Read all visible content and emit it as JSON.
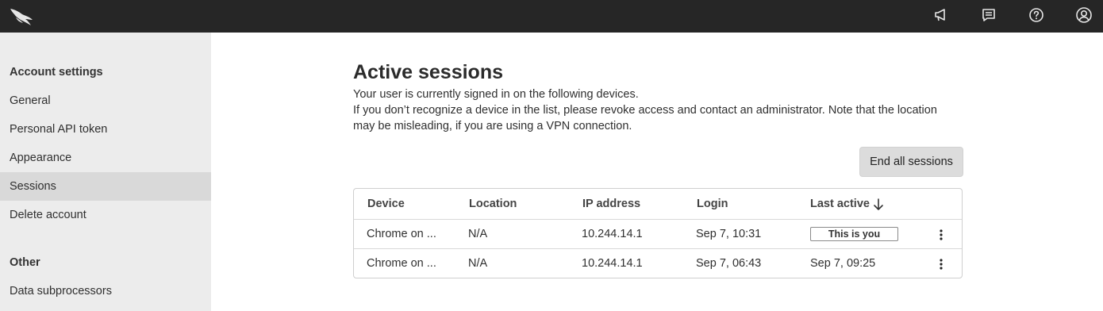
{
  "topbar": {
    "icons": [
      "falcon-logo-icon",
      "announcement-icon",
      "feedback-icon",
      "help-icon",
      "user-profile-icon"
    ]
  },
  "sidebar": {
    "section1_heading": "Account settings",
    "items": [
      {
        "label": "General"
      },
      {
        "label": "Personal API token"
      },
      {
        "label": "Appearance"
      },
      {
        "label": "Sessions",
        "active": true
      },
      {
        "label": "Delete account"
      }
    ],
    "section2_heading": "Other",
    "other_items": [
      {
        "label": "Data subprocessors"
      }
    ]
  },
  "main": {
    "title": "Active sessions",
    "desc_line1": "Your user is currently signed in on the following devices.",
    "desc_line2": "If you don’t recognize a device in the list, please revoke access and contact an administrator. Note that the location",
    "desc_line3": "may be misleading, if you are using a VPN connection.",
    "end_all_label": "End all sessions"
  },
  "table": {
    "columns": [
      "Device",
      "Location",
      "IP address",
      "Login",
      "Last active"
    ],
    "sort_column": "Last active",
    "sort_direction": "descending",
    "rows": [
      {
        "device": "Chrome on ...",
        "location": "N/A",
        "ip": "10.244.14.1",
        "login": "Sep 7, 10:31",
        "last_active": "This is you"
      },
      {
        "device": "Chrome on ...",
        "location": "N/A",
        "ip": "10.244.14.1",
        "login": "Sep 7, 06:43",
        "last_active": "Sep 7, 09:25"
      }
    ]
  },
  "colors": {
    "topbar": "#262626",
    "sidebar": "#ececec",
    "sidebar_active": "#d9d9d9",
    "button": "#dcdcdc"
  }
}
